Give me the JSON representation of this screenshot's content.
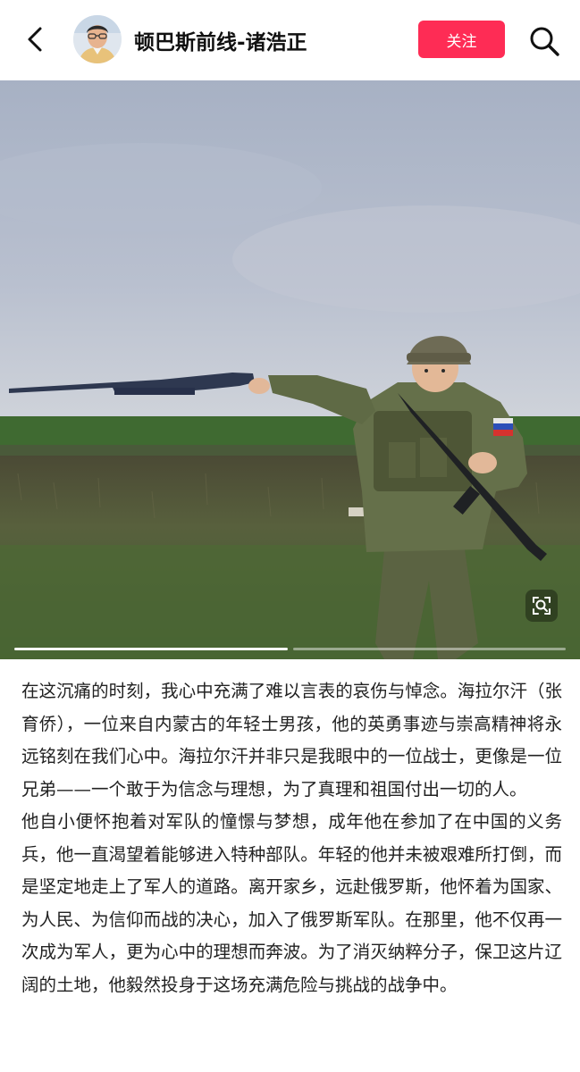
{
  "header": {
    "author_name": "顿巴斯前线-诸浩正",
    "follow_label": "关注",
    "back_icon": "chevron-left-icon",
    "search_icon": "search-icon"
  },
  "carousel": {
    "total_images": 2,
    "current_index": 1,
    "zoom_icon": "zoom-scan-icon"
  },
  "article": {
    "paragraphs": [
      "在这沉痛的时刻，我心中充满了难以言表的哀伤与悼念。海拉尔汗（张育侨），一位来自内蒙古的年轻士男孩，他的英勇事迹与崇高精神将永远铭刻在我们心中。海拉尔汗并非只是我眼中的一位战士，更像是一位兄弟——一个敢于为信念与理想，为了真理和祖国付出一切的人。",
      "他自小便怀抱着对军队的憧憬与梦想，成年他在参加了在中国的义务兵，他一直渴望着能够进入特种部队。年轻的他并未被艰难所打倒，而是坚定地走上了军人的道路。离开家乡，远赴俄罗斯，他怀着为国家、为人民、为信仰而战的决心，加入了俄罗斯军队。在那里，他不仅再一次成为军人，更为心中的理想而奔波。为了消灭纳粹分子，保卫这片辽阔的土地，他毅然投身于这场充满危险与挑战的战争中。"
    ]
  },
  "colors": {
    "follow_button": "#fe2c55",
    "text": "#222222",
    "sky": "#a9b3c6",
    "field_green": "#3f6a31"
  }
}
